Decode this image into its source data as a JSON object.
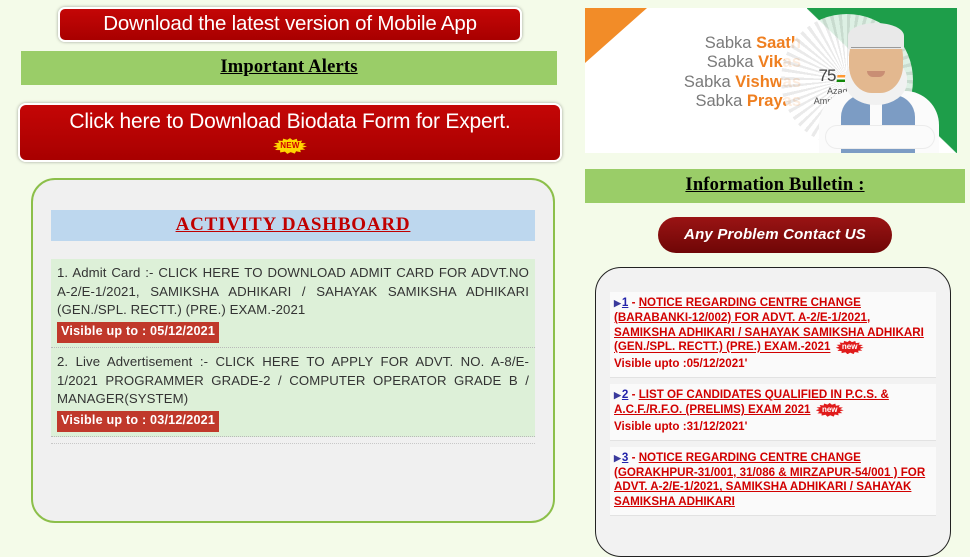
{
  "left": {
    "mobile_app_button": "Download the latest version of Mobile App",
    "important_alerts_header": "Important Alerts",
    "biodata_button": "Click here to Download Biodata Form for Expert.",
    "new_badge_label": "NEW",
    "dashboard": {
      "title": "ACTIVITY DASHBOARD",
      "items": [
        {
          "text": "1. Admit Card :- CLICK HERE TO DOWNLOAD ADMIT CARD FOR ADVT.NO A-2/E-1/2021, SAMIKSHA ADHIKARI / SAHAYAK SAMIKSHA ADHIKARI (GEN./SPL. RECTT.) (PRE.) EXAM.-2021",
          "visible_upto": "Visible up to : 05/12/2021"
        },
        {
          "text": "2. Live Advertisement :- CLICK HERE TO APPLY FOR ADVT. NO. A-8/E-1/2021 PROGRAMMER GRADE-2 / COMPUTER OPERATOR GRADE B / MANAGER(SYSTEM)",
          "visible_upto": "Visible up to : 03/12/2021"
        }
      ]
    }
  },
  "right": {
    "banner": {
      "slogan_lines": [
        {
          "prefix": "Sabka ",
          "bold": "Saath"
        },
        {
          "prefix": "Sabka ",
          "bold": "Vikas"
        },
        {
          "prefix": "Sabka ",
          "bold": "Vishwas"
        },
        {
          "prefix": "Sabka ",
          "bold": "Prayas"
        }
      ],
      "emblem_number": "75",
      "emblem_line1": "Azadi Ka",
      "emblem_line2": "Amrit Mahotsav"
    },
    "information_bulletin_header": "Information Bulletin :",
    "contact_button": "Any Problem Contact US",
    "bulletin_items": [
      {
        "number": "1",
        "title": "NOTICE REGARDING CENTRE CHANGE",
        "detail": "(BARABANKI-12/002) FOR ADVT. A-2/E-1/2021, SAMIKSHA ADHIKARI / SAHAYAK SAMIKSHA ADHIKARI (GEN./SPL. RECTT.) (PRE.) EXAM.-2021",
        "new_badge": "new",
        "visible_upto": "Visible upto :05/12/2021'"
      },
      {
        "number": "2",
        "title": "LIST OF CANDIDATES QUALIFIED IN P.C.S. & A.C.F./R.F.O. (PRELIMS) EXAM 2021",
        "detail": "",
        "new_badge": "new",
        "visible_upto": "Visible upto :31/12/2021'"
      },
      {
        "number": "3",
        "title": "NOTICE REGARDING CENTRE CHANGE",
        "detail": "(GORAKHPUR-31/001, 31/086 & MIRZAPUR-54/001 ) FOR ADVT. A-2/E-1/2021, SAMIKSHA ADHIKARI / SAHAYAK SAMIKSHA ADHIKARI",
        "new_badge": "",
        "visible_upto": ""
      }
    ]
  },
  "colors": {
    "page_bg": "#f4fbe9",
    "green_header": "#9acd68",
    "red_button": "#b80000",
    "dash_title_bg": "#bdd7ee",
    "dash_title_text": "#c00000",
    "item_bg": "#ddf0d8",
    "badge_red": "#c0392b",
    "bulletin_text": "#d10000",
    "contact_btn": "#8c0f0f"
  }
}
